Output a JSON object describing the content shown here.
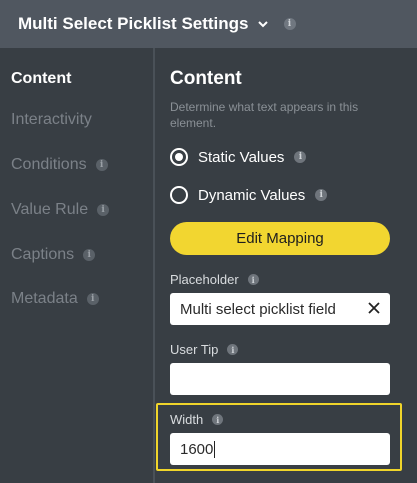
{
  "header": {
    "title": "Multi Select Picklist Settings",
    "info": "i"
  },
  "sidebar": {
    "items": [
      {
        "label": "Content"
      },
      {
        "label": "Interactivity"
      },
      {
        "label": "Conditions",
        "info": "i"
      },
      {
        "label": "Value Rule",
        "info": "i"
      },
      {
        "label": "Captions",
        "info": "i"
      },
      {
        "label": "Metadata",
        "info": "i"
      }
    ]
  },
  "content": {
    "title": "Content",
    "description": "Determine what text appears in this element.",
    "radio_static": "Static Values",
    "radio_dynamic": "Dynamic Values",
    "edit_mapping": "Edit Mapping",
    "placeholder_label": "Placeholder",
    "placeholder_value": "Multi select picklist field",
    "user_tip_label": "User Tip",
    "user_tip_value": "",
    "width_label": "Width",
    "width_value": "1600",
    "info": "i"
  },
  "colors": {
    "accent": "#f2d630",
    "header_bg": "#505760",
    "panel_bg": "#383e44"
  }
}
